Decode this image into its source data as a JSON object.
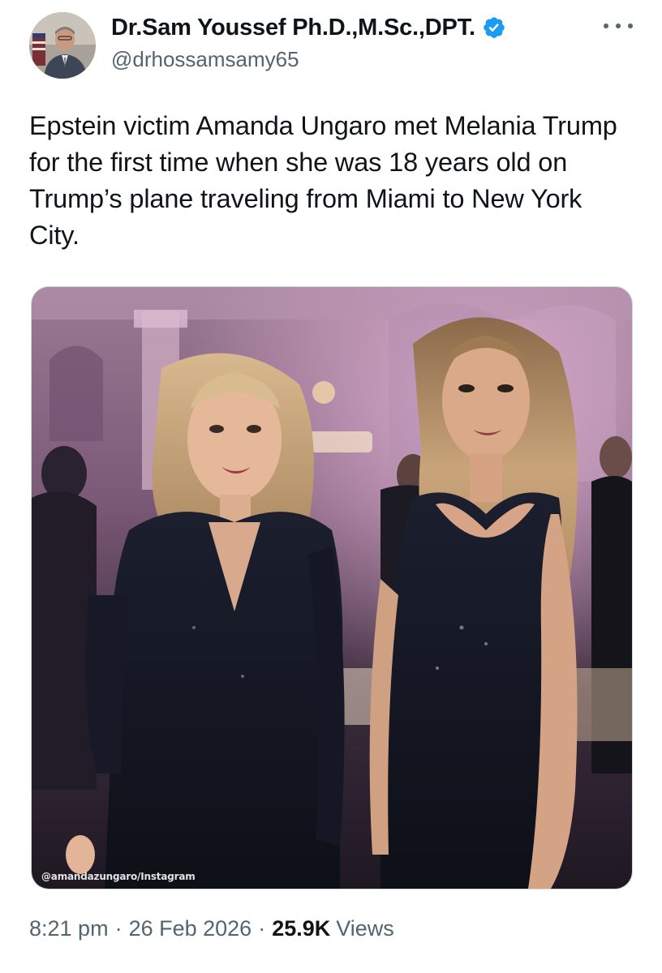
{
  "author": {
    "display_name": "Dr.Sam Youssef Ph.D.,M.Sc.,DPT.",
    "handle": "@drhossamsamy65",
    "verified": true,
    "verified_color": "#1d9bf0"
  },
  "tweet": {
    "text": "Epstein victim Amanda Ungaro met Melania Trump for the first time when she was 18 years old on Trump’s plane traveling from Miami to New York City.",
    "media": {
      "watermark": "@amandazungaro/Instagram"
    }
  },
  "meta": {
    "time": "8:21 pm",
    "separator": "·",
    "date": "26 Feb 2026",
    "views_count": "25.9K",
    "views_label": "Views"
  },
  "icons": {
    "more": "more-horizontal-icon",
    "verified": "verified-badge-icon"
  },
  "colors": {
    "text": "#0f1419",
    "secondary_text": "#536471",
    "accent": "#1d9bf0",
    "border": "#cfd9de"
  }
}
